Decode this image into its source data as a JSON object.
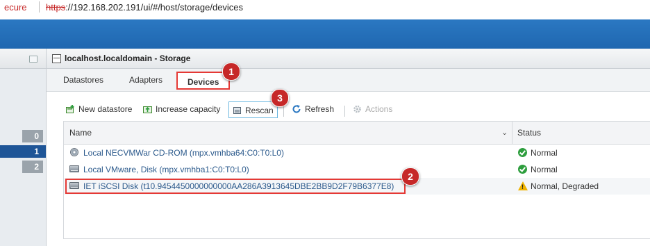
{
  "address": {
    "security": "ecure",
    "url_proto": "https",
    "url_rest": "://192.168.202.191/ui/#/host/storage/devices"
  },
  "left_counts": [
    {
      "label": "0",
      "selected": false
    },
    {
      "label": "1",
      "selected": true
    },
    {
      "label": "2",
      "selected": false
    }
  ],
  "window": {
    "title": "localhost.localdomain - Storage"
  },
  "tabs": [
    {
      "label": "Datastores",
      "active": false
    },
    {
      "label": "Adapters",
      "active": false
    },
    {
      "label": "Devices",
      "active": true
    }
  ],
  "toolbar": {
    "new_datastore": "New datastore",
    "increase_capacity": "Increase capacity",
    "rescan": "Rescan",
    "refresh": "Refresh",
    "actions": "Actions"
  },
  "grid": {
    "columns": [
      "Name",
      "Status"
    ],
    "rows": [
      {
        "name": "Local NECVMWar CD-ROM (mpx.vmhba64:C0:T0:L0)",
        "status": "Normal",
        "icon": "cdrom-icon",
        "status_icon": "ok-icon"
      },
      {
        "name": "Local VMware, Disk (mpx.vmhba1:C0:T0:L0)",
        "status": "Normal",
        "icon": "disk-icon",
        "status_icon": "ok-icon"
      },
      {
        "name": "IET iSCSI Disk (t10.9454450000000000AA286A3913645DBE2BB9D2F79B6377E8)",
        "status": "Normal, Degraded",
        "icon": "disk-icon",
        "status_icon": "warning-icon"
      }
    ]
  },
  "callouts": [
    "1",
    "2",
    "3"
  ],
  "colors": {
    "accent": "#1f67b0",
    "callout": "#c62828",
    "highlight_border": "#e53935",
    "link": "#2c5a8c",
    "ok": "#2e9e3e",
    "warning": "#f0b400"
  }
}
